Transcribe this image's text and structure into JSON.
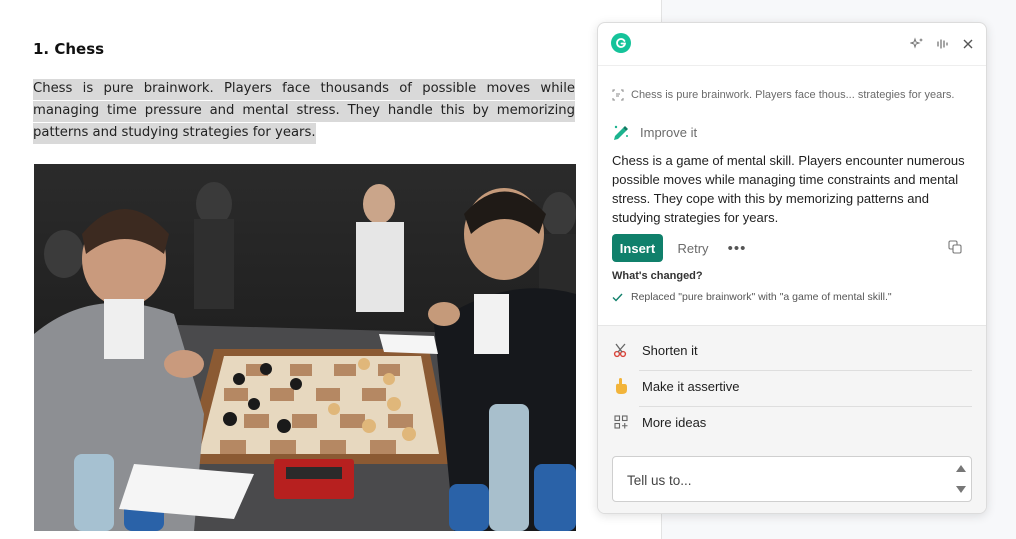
{
  "document": {
    "heading": "1. Chess",
    "paragraph": "Chess is pure brainwork. Players face thousands of possible moves while managing time pressure and mental stress. They handle this by memorizing patterns and studying strategies for years.",
    "image_icon": "chess-match-photo"
  },
  "assistant": {
    "logo_icon": "grammarly-g-icon",
    "header_icons": [
      "sparkle-icon",
      "voice-icon",
      "close-icon"
    ],
    "quote_icon": "text-selection-icon",
    "quote": "Chess is pure brainwork. Players face thous... strategies for years.",
    "mode_icon": "pencil-sparkle-icon",
    "mode_label": "Improve it",
    "suggestion": "Chess is a game of mental skill. Players encounter numerous possible moves while managing time constraints and mental stress. They cope with this by memorizing patterns and studying strategies for years.",
    "insert_label": "Insert",
    "retry_label": "Retry",
    "more_label": "•••",
    "changes_title": "What's changed?",
    "change_item": "Replaced \"pure brainwork\" with \"a game of mental skill.\"",
    "actions": [
      {
        "label": "Shorten it",
        "icon": "scissors-icon"
      },
      {
        "label": "Make it assertive",
        "icon": "pointing-hand-icon"
      },
      {
        "label": "More ideas",
        "icon": "grid-plus-icon"
      }
    ],
    "prompt_placeholder": "Tell us to...",
    "accent_color": "#10806b",
    "brand_color": "#15c39a"
  }
}
